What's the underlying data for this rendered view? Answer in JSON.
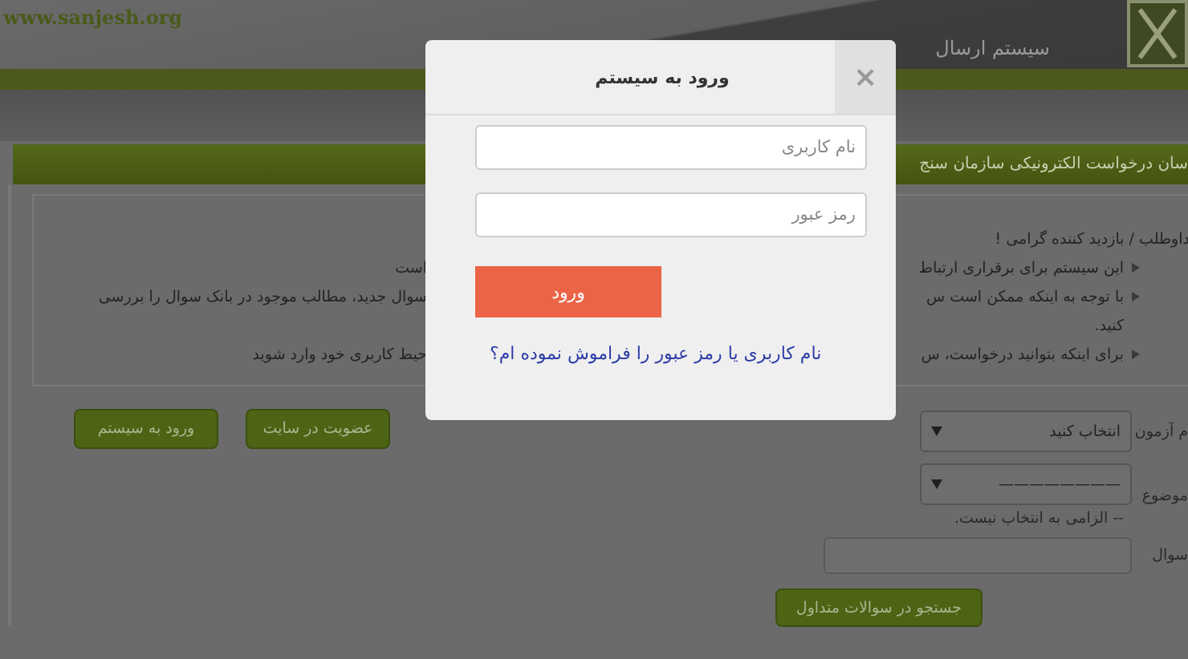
{
  "header": {
    "site_url": "www.sanjesh.org",
    "title": "سیستم ارسال"
  },
  "page_title": "سان درخواست الکترونیکی سازمان سنج",
  "notice": {
    "greeting": "داوطلب / بازدید کننده گرامی !",
    "bullets": [
      {
        "right": "این سیستم برای برقراری ارتباط",
        "left": "است"
      },
      {
        "right": "با توجه به اینکه ممکن است س",
        "left": "سوال جدید، مطالب موجود در بانک سوال را بررسی",
        "wrap": "کنید."
      },
      {
        "right": "برای اینکه بتوانید درخواست، س",
        "left": "حیط کاربری خود وارد شوید"
      }
    ]
  },
  "account_buttons": [
    "عضویت در سایت",
    "ورود به سیستم"
  ],
  "form": {
    "exam": {
      "label": "م آزمون",
      "value": "انتخاب کنید"
    },
    "topic": {
      "label": "موضوع",
      "value": "————————",
      "hint": "-- الزامی به انتخاب نیست."
    },
    "question": {
      "label": "سوال"
    },
    "search_button": "جستجو در سوالات متداول"
  },
  "modal": {
    "title": "ورود به سیستم",
    "close": "×",
    "fields": [
      {
        "placeholder": "نام کاربری"
      },
      {
        "placeholder": "رمز عبور"
      }
    ],
    "submit": "ورود",
    "forgot_link": "نام کاربری یا رمز عبور را فراموش نموده ام؟"
  }
}
